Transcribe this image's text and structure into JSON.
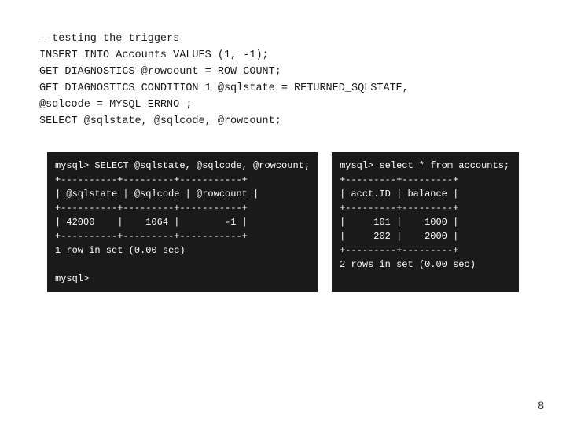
{
  "code": {
    "line1": "--testing the triggers",
    "line2": "INSERT INTO Accounts VALUES (1, -1);",
    "line3": "GET DIAGNOSTICS @rowcount = ROW_COUNT;",
    "line4": "GET DIAGNOSTICS CONDITION 1 @sqlstate = RETURNED_SQLSTATE,",
    "line5": "@sqlcode = MYSQL_ERRNO ;",
    "line6": "SELECT @sqlstate, @sqlcode, @rowcount;"
  },
  "terminal_left": {
    "content": "mysql> SELECT @sqlstate, @sqlcode, @rowcount;\n+----------+---------+-----------+\n| @sqlstate | @sqlcode | @rowcount |\n+----------+---------+-----------+\n| 42000    |    1064 |        -1 |\n+----------+---------+-----------+\n1 row in set (0.00 sec)\n\nmysql>"
  },
  "terminal_right": {
    "content": "mysql> select * from accounts;\n+---------+---------+\n| acct.ID | balance |\n+---------+---------+\n|     101 |    1000 |\n|     202 |    2000 |\n+---------+---------+\n2 rows in set (0.00 sec)"
  },
  "page_number": "8"
}
